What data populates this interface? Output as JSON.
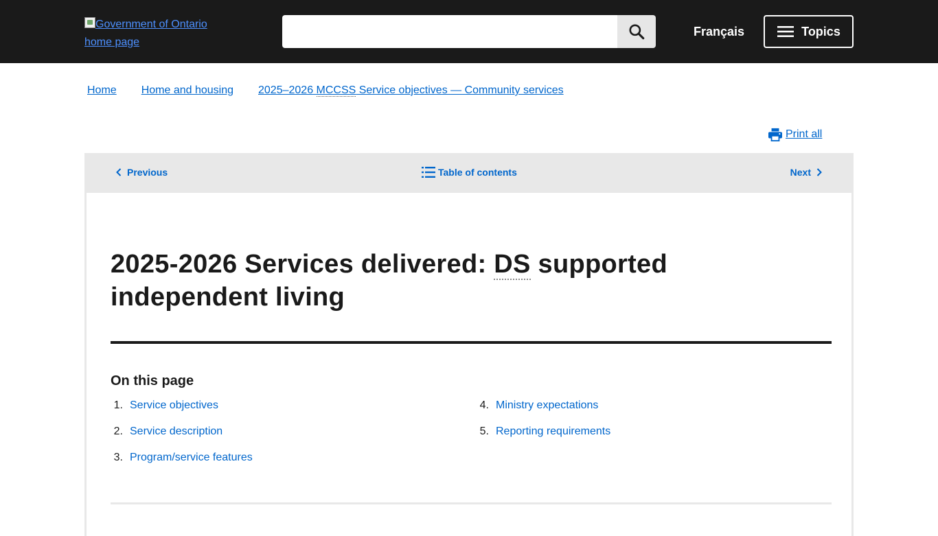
{
  "header": {
    "logo_alt_line1": "Government of Ontario",
    "logo_alt_line2": "home page",
    "search_placeholder": "",
    "language_link": "Français",
    "topics_label": "Topics"
  },
  "breadcrumb": {
    "items": [
      {
        "label": "Home"
      },
      {
        "label": "Home and housing"
      },
      {
        "label_pre": "2025–2026 ",
        "label_abbr": "MCCSS",
        "label_post": " Service objectives — Community services"
      }
    ]
  },
  "print": {
    "label": " Print all"
  },
  "pagination": {
    "previous": "Previous",
    "toc": "Table of contents",
    "next": "Next"
  },
  "main": {
    "title_pre": "2025-2026 Services delivered: ",
    "title_abbr": "DS",
    "title_post": " supported independent living",
    "on_this_page": "On this page",
    "toc_left": [
      {
        "num": "1.",
        "label": "Service objectives"
      },
      {
        "num": "2.",
        "label": "Service description"
      },
      {
        "num": "3.",
        "label": "Program/service features"
      }
    ],
    "toc_right": [
      {
        "num": "4.",
        "label": "Ministry expectations"
      },
      {
        "num": "5.",
        "label": "Reporting requirements"
      }
    ]
  },
  "colors": {
    "header_bg": "#1a1a1a",
    "link": "#0066cc",
    "nav_bar_bg": "#e8e8e8"
  }
}
